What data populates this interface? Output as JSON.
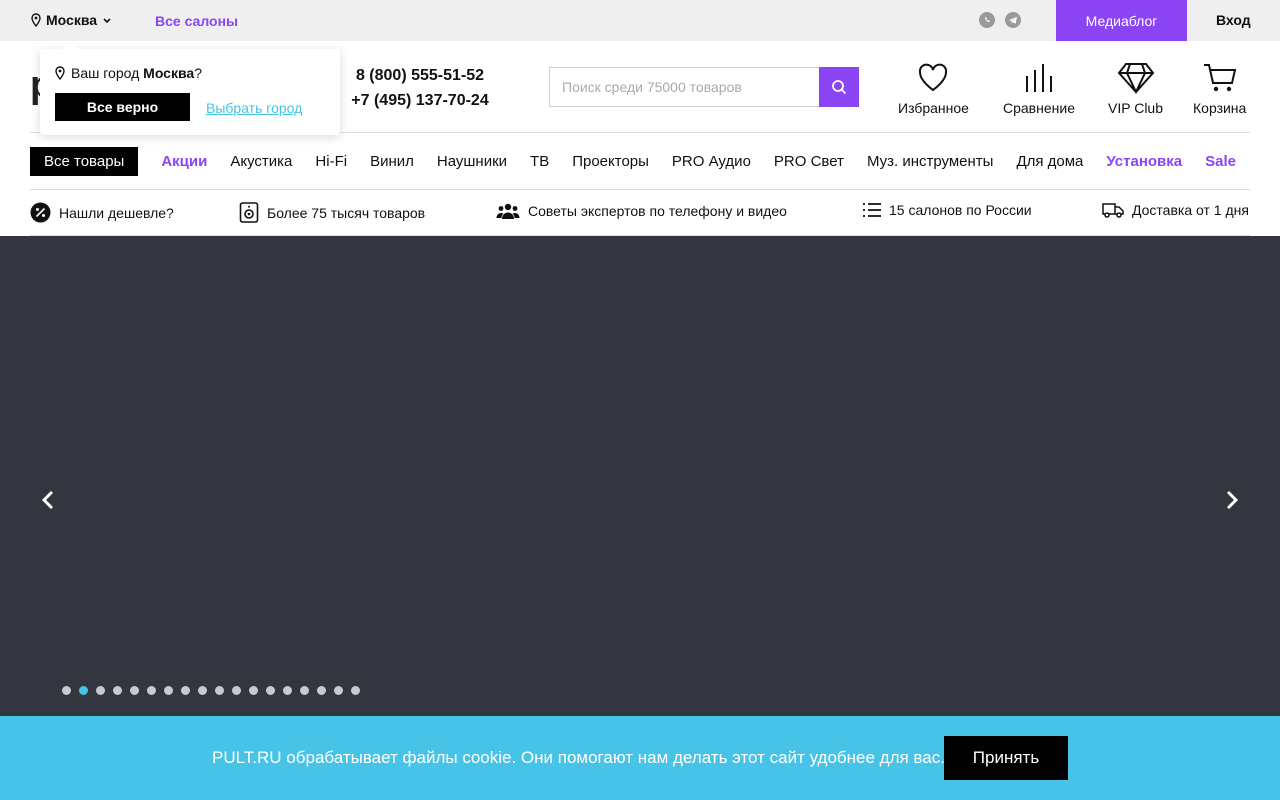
{
  "topbar": {
    "city": "Москва",
    "all_salons": "Все салоны",
    "mediablog": "Медиаблог",
    "login": "Вход"
  },
  "header": {
    "logo": "p",
    "phone1": "8 (800) 555-51-52",
    "phone2": "+7 (495) 137-70-24",
    "search_placeholder": "Поиск среди 75000 товаров",
    "favorites": "Избранное",
    "compare": "Сравнение",
    "vip": "VIP Club",
    "cart": "Корзина"
  },
  "nav": {
    "all": "Все товары",
    "items": [
      "Акции",
      "Акустика",
      "Hi-Fi",
      "Винил",
      "Наушники",
      "ТВ",
      "Проекторы",
      "PRO Аудио",
      "PRO Свет",
      "Муз. инструменты",
      "Для дома",
      "Установка",
      "Sale"
    ]
  },
  "features": {
    "cheaper": "Нашли дешевле?",
    "goods": "Более 75 тысяч товаров",
    "experts": "Советы экспертов по телефону и видео",
    "salons": "15 салонов по России",
    "delivery": "Доставка от 1 дня"
  },
  "slider": {
    "total": 18,
    "active": 2
  },
  "cookie": {
    "text": "PULT.RU обрабатывает файлы cookie. Они помогают нам делать этот сайт удобнее для вас.",
    "accept": "Принять"
  },
  "city_popup": {
    "prefix": "Ваш город",
    "city": "Москва",
    "suffix": "?",
    "confirm": "Все верно",
    "choose": "Выбрать город"
  },
  "colors": {
    "accent": "#8b45f5",
    "cyan": "#48c3e8",
    "hero": "#33363f"
  }
}
